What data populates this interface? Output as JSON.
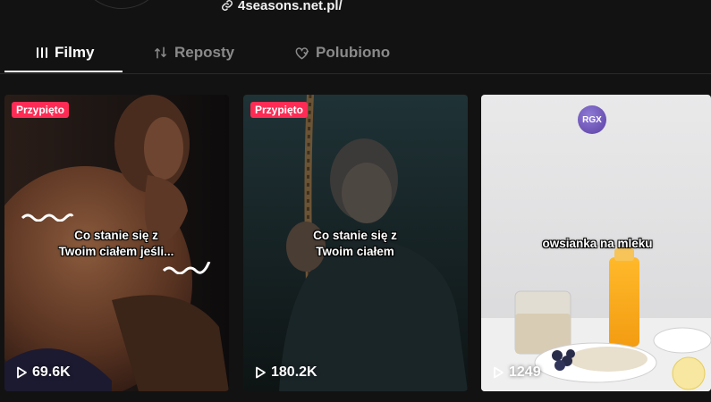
{
  "profile": {
    "link_text": "4seasons.net.pl/"
  },
  "tabs": [
    {
      "label": "Filmy",
      "icon": "grid-icon",
      "active": true
    },
    {
      "label": "Reposty",
      "icon": "repost-icon",
      "active": false
    },
    {
      "label": "Polubiono",
      "icon": "heart-icon",
      "active": false
    }
  ],
  "videos": [
    {
      "pinned_label": "Przypięto",
      "caption_line1": "Co stanie się z",
      "caption_line2": "Twoim ciałem jeśli...",
      "views": "69.6K"
    },
    {
      "pinned_label": "Przypięto",
      "caption_line1": "Co stanie się z",
      "caption_line2": "Twoim ciałem",
      "views": "180.2K"
    },
    {
      "badge": "RGX",
      "caption_line1": "owsianka na mleku",
      "views": "1249"
    }
  ],
  "colors": {
    "background": "#121212",
    "pinned_badge": "#fe2c55",
    "tab_active": "#ffffff",
    "tab_inactive": "#8a8a8a"
  }
}
